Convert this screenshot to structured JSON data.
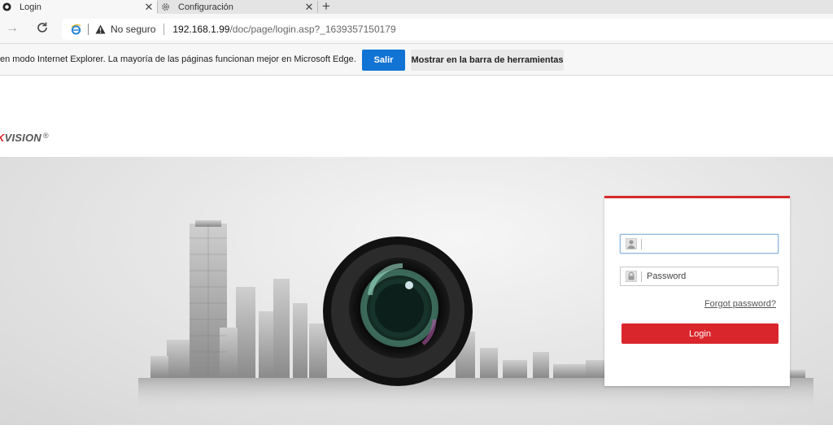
{
  "browser": {
    "tabs": [
      {
        "title": "Login",
        "active": true
      },
      {
        "title": "Configuración",
        "active": false
      }
    ],
    "address": {
      "security_label": "No seguro",
      "url_host": "192.168.1.99",
      "url_path": "/doc/page/login.asp?_1639357150179"
    }
  },
  "infobar": {
    "message": "en modo Internet Explorer. La mayoría de las páginas funcionan mejor en Microsoft Edge.",
    "exit_label": "Salir",
    "show_toolbar_label": "Mostrar en la barra de herramientas",
    "accent": "#1173d4"
  },
  "page": {
    "logo": {
      "red_part": "K",
      "rest": "VISION",
      "mark": "®"
    },
    "login": {
      "username_value": "",
      "password_placeholder": "Password",
      "forgot_label": "Forgot password?",
      "login_label": "Login",
      "accent": "#d9262c"
    }
  }
}
